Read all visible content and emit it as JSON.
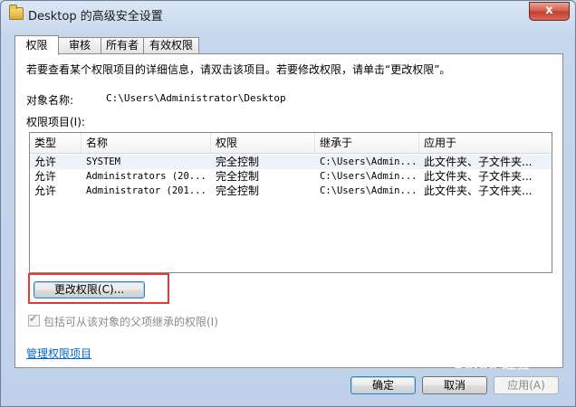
{
  "window": {
    "title": "Desktop 的高级安全设置",
    "close_glyph": "x"
  },
  "tabs": [
    {
      "label": "权限",
      "active": true
    },
    {
      "label": "审核",
      "active": false
    },
    {
      "label": "所有者",
      "active": false
    },
    {
      "label": "有效权限",
      "active": false
    }
  ],
  "panel": {
    "description": "若要查看某个权限项目的详细信息，请双击该项目。若要修改权限，请单击“更改权限”。",
    "object_name_label": "对象名称:",
    "object_name_value": "C:\\Users\\Administrator\\Desktop",
    "entries_label": "权限项目(I):",
    "columns": [
      "类型",
      "名称",
      "权限",
      "继承于",
      "应用于"
    ],
    "rows": [
      {
        "type": "允许",
        "name": "SYSTEM",
        "permission": "完全控制",
        "inherited_from": "C:\\Users\\Admin...",
        "applies_to": "此文件夹、子文件夹..."
      },
      {
        "type": "允许",
        "name": "Administrators (20...",
        "permission": "完全控制",
        "inherited_from": "C:\\Users\\Admin...",
        "applies_to": "此文件夹、子文件夹..."
      },
      {
        "type": "允许",
        "name": "Administrator (201...",
        "permission": "完全控制",
        "inherited_from": "C:\\Users\\Admin...",
        "applies_to": "此文件夹、子文件夹..."
      }
    ],
    "change_permissions_button": "更改权限(C)...",
    "inherit_checkbox_label": "包括可从该对象的父项继承的权限(I)",
    "inherit_checked": true,
    "manage_link": "管理权限项目"
  },
  "buttons": {
    "ok": "确定",
    "cancel": "取消",
    "apply": "应用(A)"
  },
  "watermark": "Baidu 经验",
  "colors": {
    "highlight_border": "#e53935",
    "link": "#0066cc"
  }
}
